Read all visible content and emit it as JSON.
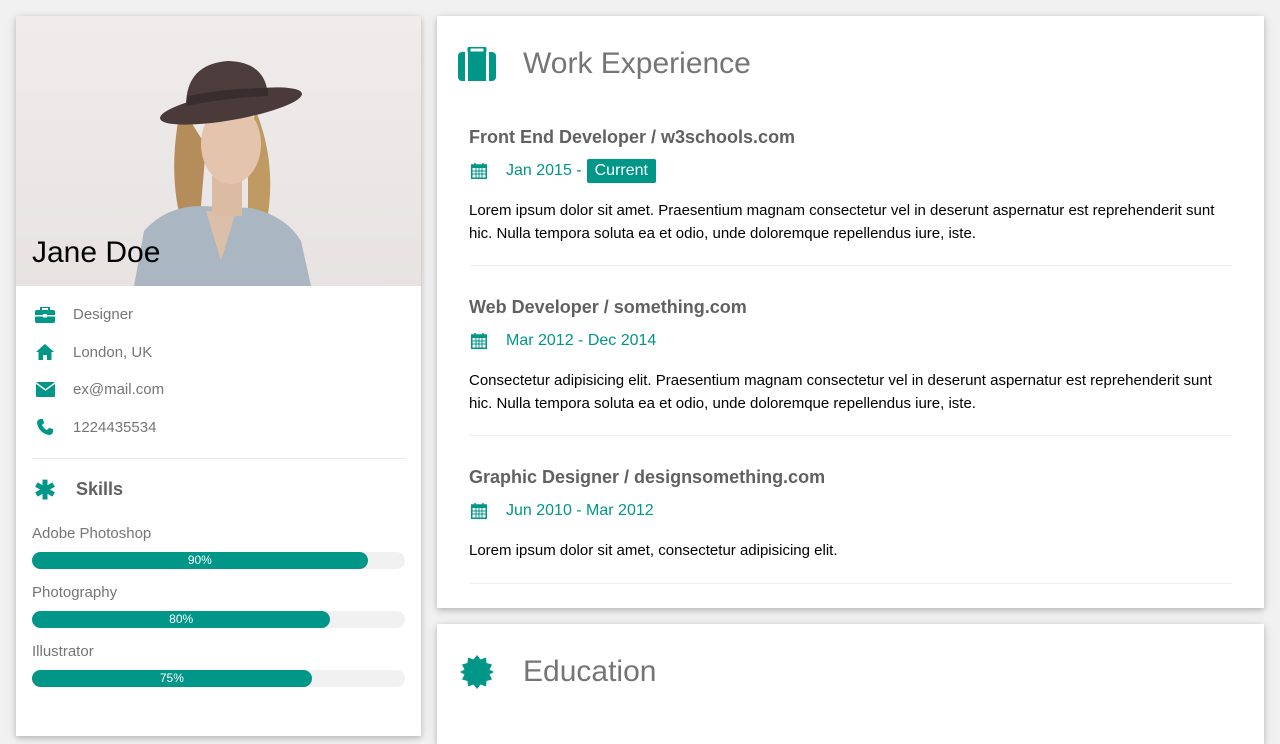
{
  "profile": {
    "name": "Jane Doe",
    "info": [
      {
        "icon": "briefcase-icon",
        "text": "Designer"
      },
      {
        "icon": "home-icon",
        "text": "London, UK"
      },
      {
        "icon": "envelope-icon",
        "text": "ex@mail.com"
      },
      {
        "icon": "phone-icon",
        "text": "1224435534"
      }
    ]
  },
  "skills": {
    "title": "Skills",
    "items": [
      {
        "name": "Adobe Photoshop",
        "label": "90%",
        "percent": 90
      },
      {
        "name": "Photography",
        "label": "80%",
        "percent": 80
      },
      {
        "name": "Illustrator",
        "label": "75%",
        "percent": 75
      }
    ]
  },
  "work": {
    "title": "Work Experience",
    "jobs": [
      {
        "title": "Front End Developer / w3schools.com",
        "date": "Jan 2015 -",
        "current": "Current",
        "desc": "Lorem ipsum dolor sit amet. Praesentium magnam consectetur vel in deserunt aspernatur est reprehenderit sunt hic. Nulla tempora soluta ea et odio, unde doloremque repellendus iure, iste."
      },
      {
        "title": "Web Developer / something.com",
        "date": "Mar 2012 - Dec 2014",
        "desc": "Consectetur adipisicing elit. Praesentium magnam consectetur vel in deserunt aspernatur est reprehenderit sunt hic. Nulla tempora soluta ea et odio, unde doloremque repellendus iure, iste."
      },
      {
        "title": "Graphic Designer / designsomething.com",
        "date": "Jun 2010 - Mar 2012",
        "desc": "Lorem ipsum dolor sit amet, consectetur adipisicing elit."
      }
    ]
  },
  "education": {
    "title": "Education"
  },
  "colors": {
    "accent": "#009688",
    "text_muted": "#757575",
    "background": "#f1f1f1"
  }
}
